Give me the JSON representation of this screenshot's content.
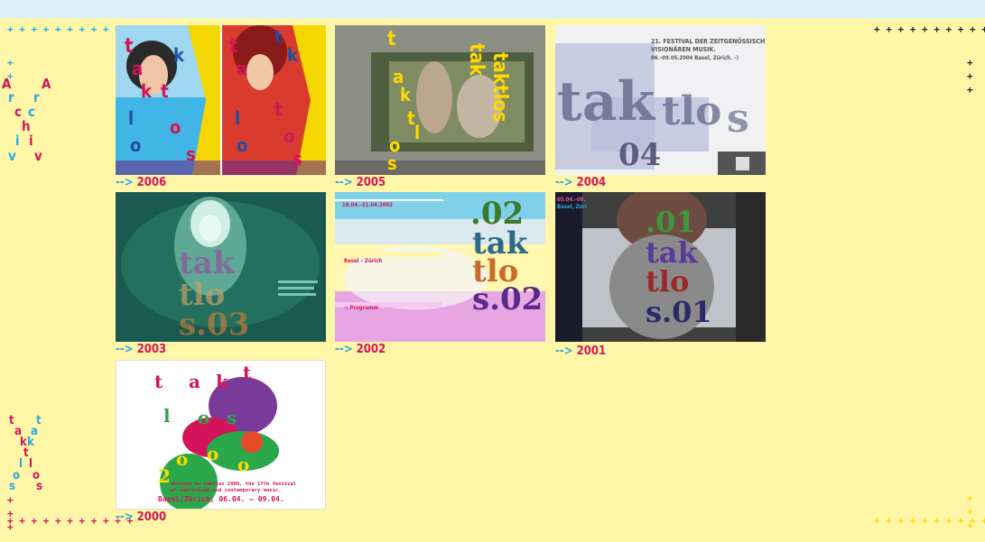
{
  "nav": {
    "title_letters": [
      "A",
      "A",
      "r",
      "r",
      "c",
      "c",
      "h",
      "i",
      "i",
      "v",
      "v"
    ],
    "logo_letters": [
      "t",
      "t",
      "a",
      "a",
      "k",
      "k",
      "t",
      "l",
      "l",
      "o",
      "o",
      "s",
      "s"
    ]
  },
  "decor": {
    "plus_row": "+ + + + + + + + + + +",
    "plus": "+"
  },
  "posters": [
    {
      "year": "2006",
      "arrow": "-->"
    },
    {
      "year": "2005",
      "arrow": "-->"
    },
    {
      "year": "2004",
      "arrow": "-->"
    },
    {
      "year": "2003",
      "arrow": "-->"
    },
    {
      "year": "2002",
      "arrow": "-->"
    },
    {
      "year": "2001",
      "arrow": "-->"
    },
    {
      "year": "2000",
      "arrow": "-->"
    }
  ],
  "poster_text": {
    "p2004_header": "21. FESTIVAL DER ZEITGENÖSSISCH",
    "p2004_sub": "VISIONÄREN MUSIK.",
    "p2004_dates": "06.–09.05.2004 Basel, Zürich. –)",
    "p2002_dates": "18.04.–21.04.2002",
    "p2002_city": "Basel – Zürich",
    "p2002_prog": "→ Programm",
    "p2001_dates": "05.04.–08.",
    "p2001_city": "Basel, Züri",
    "p2000_line1": "Welcome to taktlos 2000, the 17th festival",
    "p2000_line2": "of improvised and contemporary music.",
    "p2000_line3": "Basel/Zürich, 06.04. – 09.04.",
    "p2003_num": "s.03",
    "p2002_num": "s.02",
    "p2002_top": ".02",
    "p2001_top": ".01",
    "p2001_num": "s.01",
    "p2004_num": "04",
    "p2000_num": "2"
  },
  "colors": {
    "bg": "#fff6a8",
    "topbar": "#d9effb",
    "accent_cyan": "#29a8e0",
    "accent_magenta": "#d4145a",
    "accent_yellow": "#ffd800"
  }
}
